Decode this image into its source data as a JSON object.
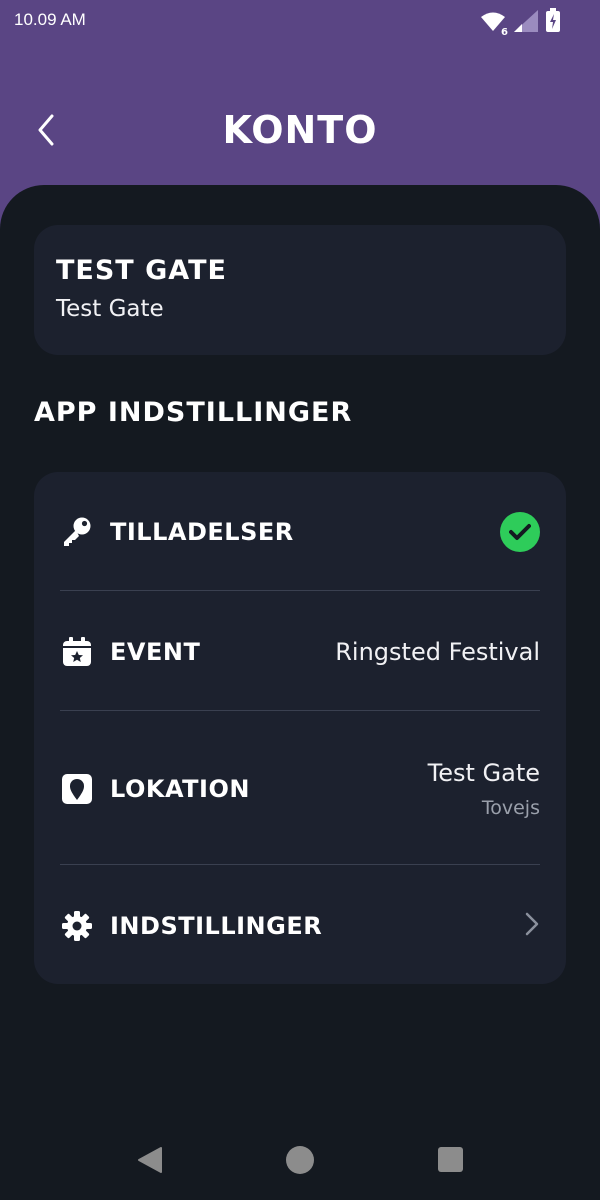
{
  "status_bar": {
    "time": "10.09 AM",
    "network_badge": "6"
  },
  "header": {
    "title": "KONTO"
  },
  "profile": {
    "name": "TEST GATE",
    "subtitle": "Test Gate"
  },
  "section": {
    "title": "APP INDSTILLINGER"
  },
  "settings": {
    "permissions": {
      "label": "TILLADELSER",
      "icon": "key-icon",
      "status": "granted"
    },
    "event": {
      "label": "EVENT",
      "icon": "calendar-icon",
      "value": "Ringsted Festival"
    },
    "location": {
      "label": "LOKATION",
      "icon": "location-pin-icon",
      "value": "Test Gate",
      "sub": "Tovejs"
    },
    "preferences": {
      "label": "INDSTILLINGER",
      "icon": "gear-icon"
    }
  },
  "colors": {
    "header_bg": "#5a4584",
    "content_bg": "#141920",
    "card_bg": "#1c212e",
    "success": "#2ecc5a"
  }
}
